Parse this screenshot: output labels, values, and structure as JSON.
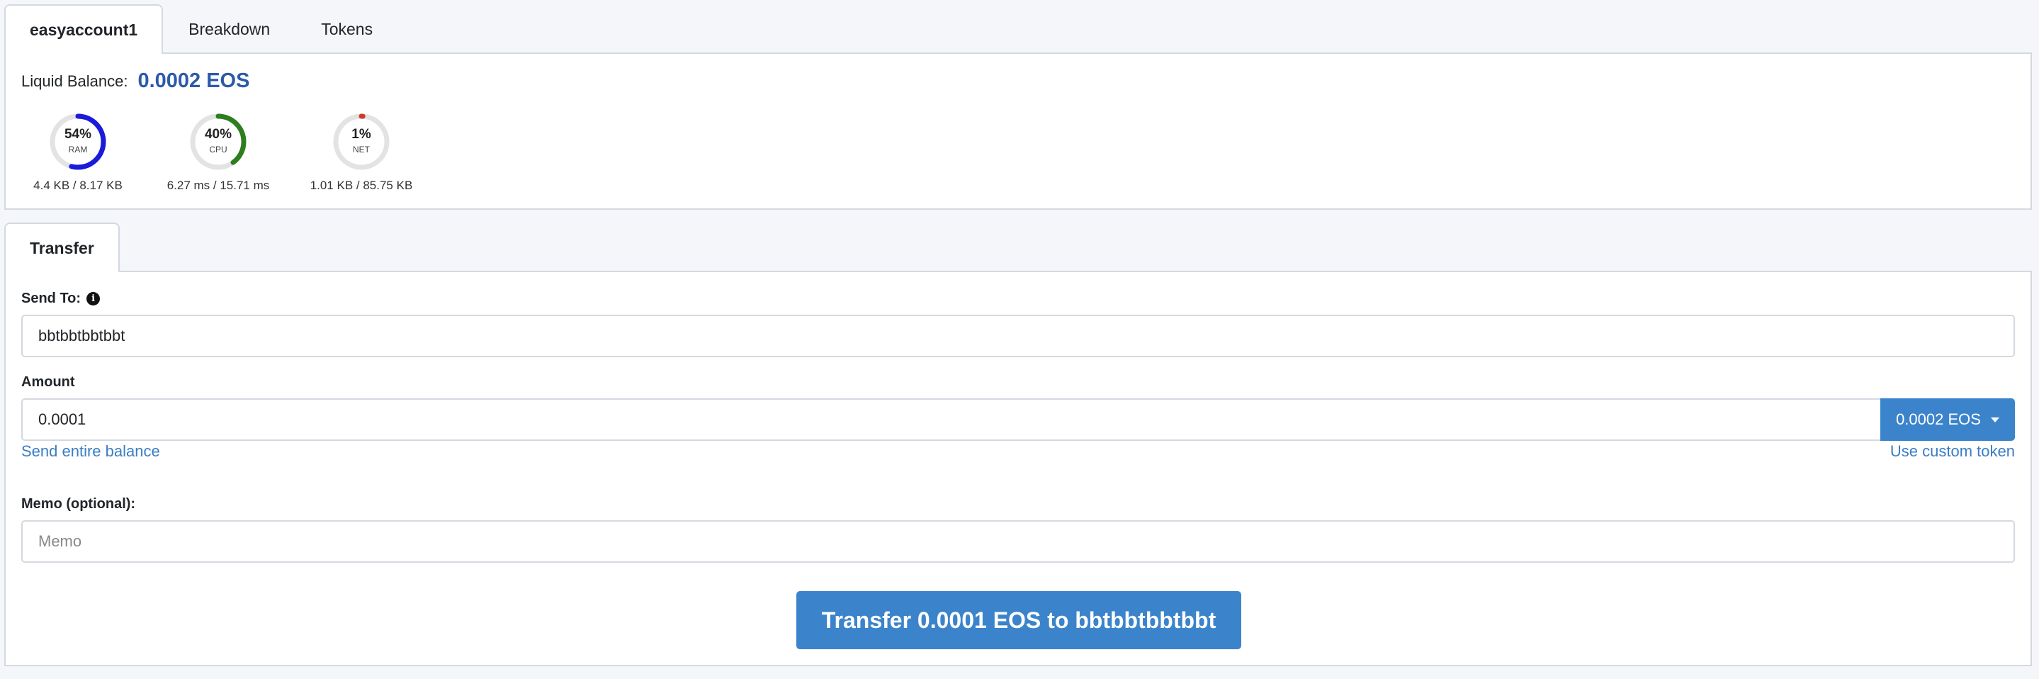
{
  "account_tabs": [
    {
      "label": "easyaccount1",
      "active": true
    },
    {
      "label": "Breakdown",
      "active": false
    },
    {
      "label": "Tokens",
      "active": false
    }
  ],
  "balance": {
    "label": "Liquid Balance:",
    "value": "0.0002 EOS"
  },
  "resources": [
    {
      "name": "RAM",
      "percent_text": "54%",
      "percent": 54,
      "usage": "4.4 KB / 8.17 KB",
      "color": "#1a1adb"
    },
    {
      "name": "CPU",
      "percent_text": "40%",
      "percent": 40,
      "usage": "6.27 ms / 15.71 ms",
      "color": "#2e7d1f"
    },
    {
      "name": "NET",
      "percent_text": "1%",
      "percent": 1,
      "usage": "1.01 KB / 85.75 KB",
      "color": "#d03a2a"
    }
  ],
  "transfer_tabs": [
    {
      "label": "Transfer",
      "active": true
    }
  ],
  "form": {
    "send_to": {
      "label": "Send To:",
      "value": "bbtbbtbbtbbt",
      "info_icon": "info-circle"
    },
    "amount": {
      "label": "Amount",
      "value": "0.0001",
      "token_button": "0.0002 EOS"
    },
    "send_entire_balance": "Send entire balance",
    "use_custom_token": "Use custom token",
    "memo": {
      "label": "Memo (optional):",
      "placeholder": "Memo",
      "value": ""
    },
    "submit_label": "Transfer 0.0001 EOS to bbtbbtbbtbbt"
  },
  "colors": {
    "accent": "#3b84cc",
    "balance_text": "#2c5aa8",
    "link": "#3b7dc4"
  }
}
